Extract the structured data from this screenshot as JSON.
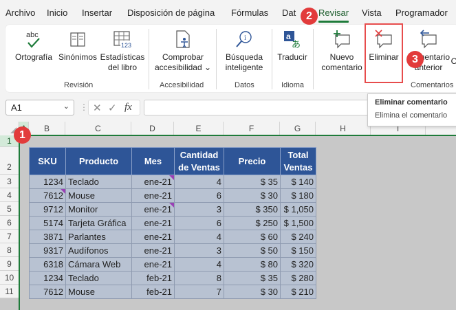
{
  "menu": [
    "Archivo",
    "Inicio",
    "Insertar",
    "Disposición de página",
    "Fórmulas",
    "Dat",
    "Revisar",
    "Vista",
    "Programador"
  ],
  "menu_active": "Revisar",
  "ribbon": {
    "ortografia": "Ortografía",
    "sinonimos": "Sinónimos",
    "estadisticas_1": "Estadísticas",
    "estadisticas_2": "del libro",
    "comprobar_1": "Comprobar",
    "comprobar_2": "accesibilidad",
    "busqueda_1": "Búsqueda",
    "busqueda_2": "inteligente",
    "traducir": "Traducir",
    "nuevo_1": "Nuevo",
    "nuevo_2": "comentario",
    "eliminar": "Eliminar",
    "anterior_1": "Comentario",
    "anterior_2": "anterior",
    "next_partial": "C",
    "groups": {
      "revision": "Revisión",
      "accesibilidad": "Accesibilidad",
      "datos": "Datos",
      "idioma": "Idioma",
      "comentarios": "Comentarios"
    }
  },
  "badges": {
    "one": "1",
    "two": "2",
    "three": "3"
  },
  "namebox": "A1",
  "fx_label": "fx",
  "tooltip": {
    "title": "Eliminar comentario",
    "body": "Elimina el comentario"
  },
  "colors": {
    "accent": "#1e7b3a",
    "header_bg": "#2e5597",
    "cell_bg": "#b8c2d2",
    "badge": "#e23b3b",
    "comment_marker": "#9b3fb5"
  },
  "columns": [
    "A",
    "B",
    "C",
    "D",
    "E",
    "F",
    "G",
    "H",
    "I"
  ],
  "rows": [
    "1",
    "2",
    "3",
    "4",
    "5",
    "6",
    "7",
    "8",
    "9",
    "10",
    "11"
  ],
  "table": {
    "headers": [
      "SKU",
      "Producto",
      "Mes",
      "Cantidad de Ventas",
      "Precio",
      "Total Ventas"
    ],
    "header_lines": [
      [
        "SKU"
      ],
      [
        "Producto"
      ],
      [
        "Mes"
      ],
      [
        "Cantidad",
        "de Ventas"
      ],
      [
        "Precio"
      ],
      [
        "Total",
        "Ventas"
      ]
    ],
    "rows": [
      {
        "sku": "1234",
        "producto": "Teclado",
        "mes": "ene-21",
        "cantidad": "4",
        "precio": "$ 35",
        "total": "$ 140",
        "comment_sku": false,
        "comment_mes": true
      },
      {
        "sku": "7612",
        "producto": "Mouse",
        "mes": "ene-21",
        "cantidad": "6",
        "precio": "$ 30",
        "total": "$ 180",
        "comment_sku": true,
        "comment_mes": false
      },
      {
        "sku": "9712",
        "producto": "Monitor",
        "mes": "ene-21",
        "cantidad": "3",
        "precio": "$ 350",
        "total": "$ 1,050",
        "comment_sku": false,
        "comment_mes": true
      },
      {
        "sku": "5174",
        "producto": "Tarjeta Gráfica",
        "mes": "ene-21",
        "cantidad": "6",
        "precio": "$ 250",
        "total": "$ 1,500",
        "comment_sku": false,
        "comment_mes": false
      },
      {
        "sku": "3871",
        "producto": "Parlantes",
        "mes": "ene-21",
        "cantidad": "4",
        "precio": "$ 60",
        "total": "$ 240",
        "comment_sku": false,
        "comment_mes": false
      },
      {
        "sku": "9317",
        "producto": "Audífonos",
        "mes": "ene-21",
        "cantidad": "3",
        "precio": "$ 50",
        "total": "$ 150",
        "comment_sku": false,
        "comment_mes": false
      },
      {
        "sku": "6318",
        "producto": "Cámara Web",
        "mes": "ene-21",
        "cantidad": "4",
        "precio": "$ 80",
        "total": "$ 320",
        "comment_sku": false,
        "comment_mes": false
      },
      {
        "sku": "1234",
        "producto": "Teclado",
        "mes": "feb-21",
        "cantidad": "8",
        "precio": "$ 35",
        "total": "$ 280",
        "comment_sku": false,
        "comment_mes": false
      },
      {
        "sku": "7612",
        "producto": "Mouse",
        "mes": "feb-21",
        "cantidad": "7",
        "precio": "$ 30",
        "total": "$ 210",
        "comment_sku": false,
        "comment_mes": false
      }
    ]
  }
}
